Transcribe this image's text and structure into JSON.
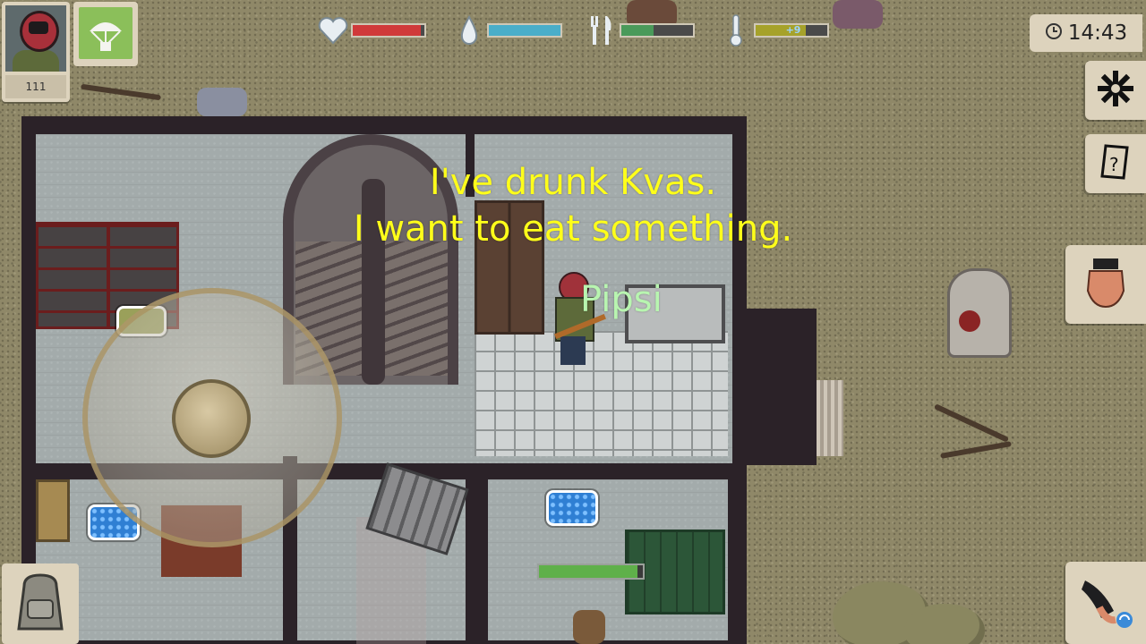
{
  "hud": {
    "player_level": "111",
    "clock": "14:43",
    "temperature_value": "+9",
    "stats": {
      "health": 0.95,
      "thirst": 1.0,
      "hunger": 0.45,
      "temperature": 0.7
    },
    "colors": {
      "health": "#d03a3a",
      "thirst": "#4aaec9",
      "hunger": "#4a9a5a",
      "temperature": "#a6a22a"
    },
    "icons": {
      "health": "heart-icon",
      "thirst": "water-drop-icon",
      "hunger": "fork-knife-icon",
      "temperature": "thermometer-icon",
      "clock": "clock-icon",
      "airdrop": "parachute-icon",
      "settings": "gear-icon",
      "quests": "notepad-icon",
      "interact": "hand-icon",
      "switch": "swap-icon",
      "inventory": "backpack-icon"
    }
  },
  "dialogue": {
    "lines": [
      "I've drunk Kvas.",
      "I want to eat something."
    ],
    "color": "#ffff1a"
  },
  "player": {
    "name": "Pipsi",
    "name_color": "#b8f5b0",
    "health": 0.95
  }
}
